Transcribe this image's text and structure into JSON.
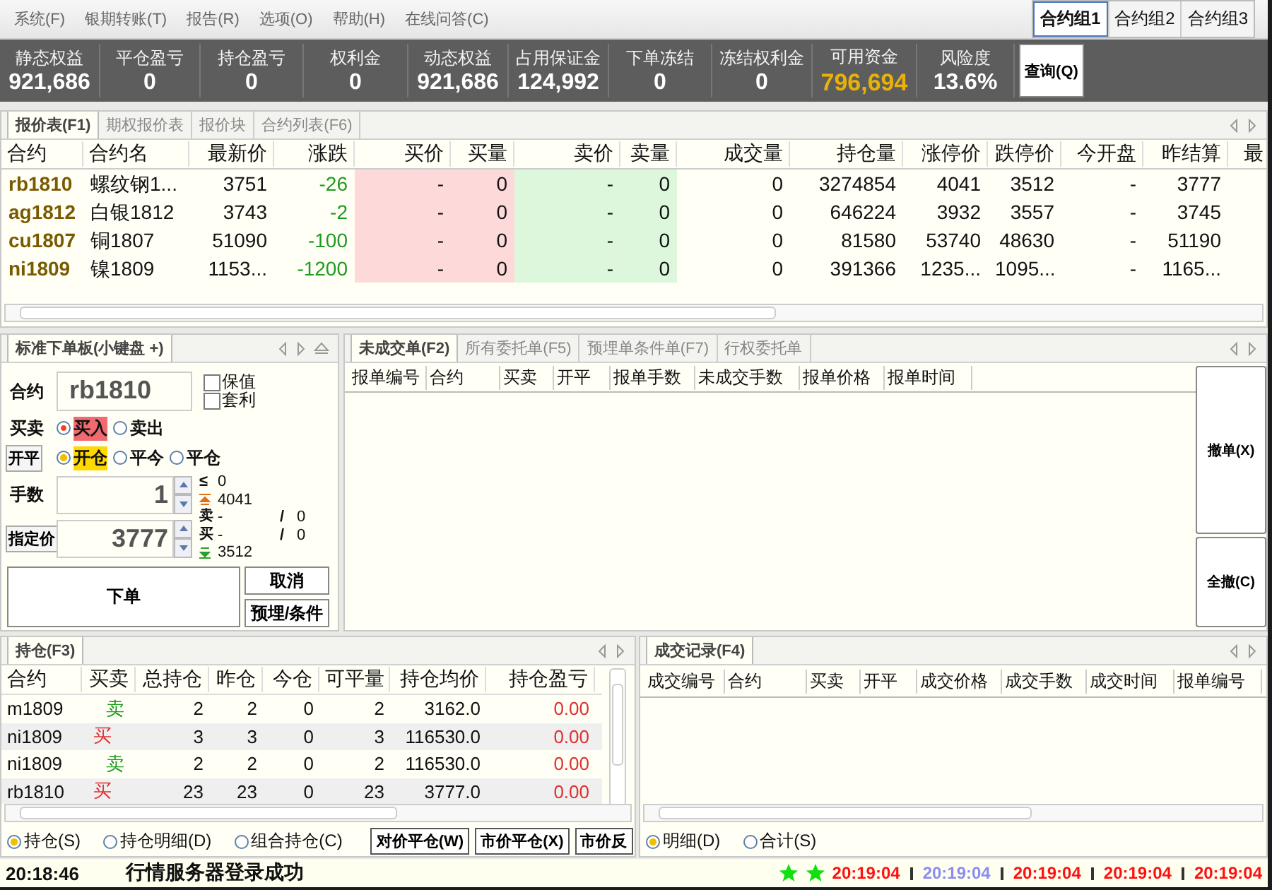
{
  "menu": [
    "系统(F)",
    "银期转账(T)",
    "报告(R)",
    "选项(O)",
    "帮助(H)",
    "在线问答(C)"
  ],
  "contract_groups": [
    {
      "label": "合约组1",
      "selected": true
    },
    {
      "label": "合约组2",
      "selected": false
    },
    {
      "label": "合约组3",
      "selected": false
    }
  ],
  "account": [
    {
      "label": "静态权益",
      "value": "921,686",
      "highlight": false
    },
    {
      "label": "平仓盈亏",
      "value": "0",
      "highlight": false
    },
    {
      "label": "持仓盈亏",
      "value": "0",
      "highlight": false
    },
    {
      "label": "权利金",
      "value": "0",
      "highlight": false
    },
    {
      "label": "动态权益",
      "value": "921,686",
      "highlight": false
    },
    {
      "label": "占用保证金",
      "value": "124,992",
      "highlight": false
    },
    {
      "label": "下单冻结",
      "value": "0",
      "highlight": false
    },
    {
      "label": "冻结权利金",
      "value": "0",
      "highlight": false
    },
    {
      "label": "可用资金",
      "value": "796,694",
      "highlight": true
    },
    {
      "label": "风险度",
      "value": "13.6%",
      "highlight": false
    }
  ],
  "query_button": "查询(Q)",
  "quote_panel": {
    "tabs": [
      {
        "label": "报价表(F1)",
        "selected": true
      },
      {
        "label": "期权报价表",
        "selected": false
      },
      {
        "label": "报价块",
        "selected": false
      },
      {
        "label": "合约列表(F6)",
        "selected": false
      }
    ],
    "columns": [
      "合约",
      "合约名",
      "最新价",
      "涨跌",
      "买价",
      "买量",
      "卖价",
      "卖量",
      "成交量",
      "持仓量",
      "涨停价",
      "跌停价",
      "今开盘",
      "昨结算",
      "最"
    ],
    "rows": [
      [
        "rb1810",
        "螺纹钢1...",
        "3751",
        "-26",
        "-",
        "0",
        "-",
        "0",
        "0",
        "3274854",
        "4041",
        "3512",
        "-",
        "3777"
      ],
      [
        "ag1812",
        "白银1812",
        "3743",
        "-2",
        "-",
        "0",
        "-",
        "0",
        "0",
        "646224",
        "3932",
        "3557",
        "-",
        "3745"
      ],
      [
        "cu1807",
        "铜1807",
        "51090",
        "-100",
        "-",
        "0",
        "-",
        "0",
        "0",
        "81580",
        "53740",
        "48630",
        "-",
        "51190"
      ],
      [
        "ni1809",
        "镍1809",
        "1153...",
        "-1200",
        "-",
        "0",
        "-",
        "0",
        "0",
        "391366",
        "1235...",
        "1095...",
        "-",
        "1165..."
      ]
    ]
  },
  "order_panel": {
    "tab": "标准下单板(小键盘 +)",
    "contract_label": "合约",
    "contract": "rb1810",
    "options": [
      {
        "label": "保值",
        "checked": false
      },
      {
        "label": "套利",
        "checked": false
      }
    ],
    "side_label": "买卖",
    "sides": [
      {
        "label": "买入",
        "selected": true
      },
      {
        "label": "卖出",
        "selected": false
      }
    ],
    "offset_button": "开平",
    "offsets": [
      {
        "label": "开仓",
        "selected": true
      },
      {
        "label": "平今",
        "selected": false
      },
      {
        "label": "平仓",
        "selected": false
      }
    ],
    "qty_label": "手数",
    "qty": "1",
    "qty_max_sign": "≤",
    "qty_max": "0",
    "upper_limit": "4041",
    "price_button": "指定价",
    "price": "3777",
    "ask_label": "卖",
    "ask": "-",
    "ask_sep": "/",
    "ask_vol": "0",
    "bid_label": "买",
    "bid": "-",
    "bid_sep": "/",
    "bid_vol": "0",
    "lower_limit": "3512",
    "submit": "下单",
    "cancel": "取消",
    "preset": "预埋/条件"
  },
  "orders_panel": {
    "tabs": [
      {
        "label": "未成交单(F2)",
        "selected": true
      },
      {
        "label": "所有委托单(F5)",
        "selected": false
      },
      {
        "label": "预埋单条件单(F7)",
        "selected": false
      },
      {
        "label": "行权委托单",
        "selected": false
      }
    ],
    "columns": [
      "报单编号",
      "合约",
      "买卖",
      "开平",
      "报单手数",
      "未成交手数",
      "报单价格",
      "报单时间"
    ],
    "buttons": [
      "撤单(X)",
      "全撤(C)"
    ]
  },
  "positions_panel": {
    "tab": "持仓(F3)",
    "columns": [
      "合约",
      "买卖",
      "总持仓",
      "昨仓",
      "今仓",
      "可平量",
      "持仓均价",
      "持仓盈亏"
    ],
    "rows": [
      {
        "kind": "sell",
        "cells": [
          "m1809",
          "卖",
          "2",
          "2",
          "0",
          "2",
          "3162.0",
          "0.00"
        ]
      },
      {
        "kind": "buy",
        "cells": [
          "ni1809",
          "买",
          "3",
          "3",
          "0",
          "3",
          "116530.0",
          "0.00"
        ]
      },
      {
        "kind": "sell",
        "cells": [
          "ni1809",
          "卖",
          "2",
          "2",
          "0",
          "2",
          "116530.0",
          "0.00"
        ]
      },
      {
        "kind": "buy",
        "cells": [
          "rb1810",
          "买",
          "23",
          "23",
          "0",
          "23",
          "3777.0",
          "0.00"
        ]
      }
    ],
    "radios": [
      {
        "label": "持仓(S)",
        "selected": true
      },
      {
        "label": "持仓明细(D)",
        "selected": false
      },
      {
        "label": "组合持仓(C)",
        "selected": false
      }
    ],
    "buttons": [
      "对价平仓(W)",
      "市价平仓(X)",
      "市价反"
    ]
  },
  "trades_panel": {
    "tab": "成交记录(F4)",
    "columns": [
      "成交编号",
      "合约",
      "买卖",
      "开平",
      "成交价格",
      "成交手数",
      "成交时间",
      "报单编号"
    ],
    "radios": [
      {
        "label": "明细(D)",
        "selected": true
      },
      {
        "label": "合计(S)",
        "selected": false
      }
    ]
  },
  "status_bar": {
    "time": "20:18:46",
    "message": "行情服务器登录成功",
    "clocks": [
      {
        "text": "20:19:04",
        "color": "#ff1010"
      },
      {
        "text": "20:19:04",
        "color": "#8c8cf0"
      },
      {
        "text": "20:19:04",
        "color": "#ff1010"
      },
      {
        "text": "20:19:04",
        "color": "#ff1010"
      },
      {
        "text": "20:19:04",
        "color": "#ff1010"
      }
    ]
  }
}
